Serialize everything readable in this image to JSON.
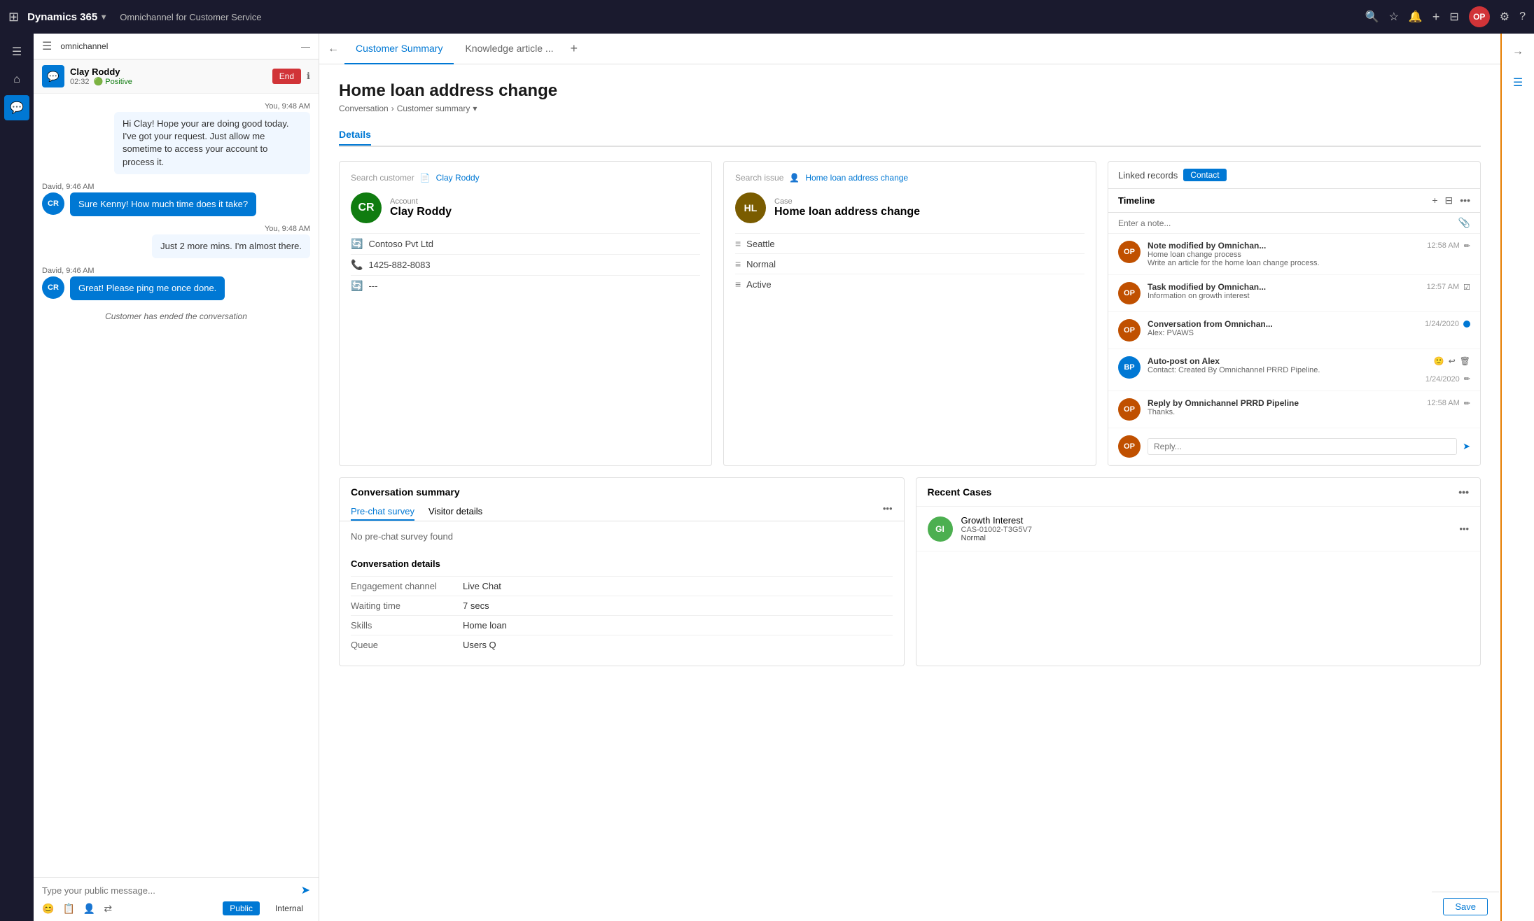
{
  "app": {
    "name": "Dynamics 365",
    "context": "Omnichannel for Customer Service"
  },
  "topnav": {
    "search_icon": "🔍",
    "star_icon": "☆",
    "bell_icon": "🔔",
    "plus_icon": "+",
    "filter_icon": "⊟",
    "settings_icon": "⚙",
    "help_icon": "?",
    "user_initials": "OP"
  },
  "sidebar": {
    "channel_label": "omnichannel"
  },
  "conversation": {
    "name": "Clay Roddy",
    "time": "02:32",
    "sentiment": "Positive",
    "end_button": "End",
    "messages": [
      {
        "id": 1,
        "sender": "you",
        "time": "You, 9:48 AM",
        "text": "Hi Clay! Hope your are doing good today. I've got your request. Just allow me sometime to access your account to process it."
      },
      {
        "id": 2,
        "sender": "CR",
        "time": "David, 9:46 AM",
        "text": "Sure Kenny! How much time does it take?"
      },
      {
        "id": 3,
        "sender": "you",
        "time": "You, 9:48 AM",
        "text": "Just 2 more mins. I'm almost there."
      },
      {
        "id": 4,
        "sender": "CR",
        "time": "David, 9:46 AM",
        "text": "Great! Please ping me once done."
      }
    ],
    "system_msg": "Customer has ended the conversation",
    "input_placeholder": "Type your public message...",
    "public_btn": "Public",
    "internal_btn": "Internal"
  },
  "tabs": {
    "customer_summary": "Customer Summary",
    "knowledge_article": "Knowledge article ...",
    "add_icon": "+"
  },
  "main": {
    "page_title": "Home loan address change",
    "breadcrumb_conversation": "Conversation",
    "breadcrumb_summary": "Customer summary",
    "details_tab": "Details",
    "customer_card": {
      "search_label": "Search customer",
      "search_link": "Clay Roddy",
      "account_label": "Account",
      "name": "Clay Roddy",
      "initials": "CR",
      "avatar_bg": "#107c10",
      "company": "Contoso Pvt Ltd",
      "phone": "1425-882-8083",
      "field3": "---"
    },
    "case_card": {
      "search_label": "Search issue",
      "search_link": "Home loan address change",
      "case_label": "Case",
      "title": "Home loan address change",
      "initials": "HL",
      "avatar_bg": "#7a5c00",
      "location": "Seattle",
      "priority": "Normal",
      "status": "Active"
    },
    "timeline": {
      "linked_records": "Linked records",
      "contact_btn": "Contact",
      "timeline_label": "Timeline",
      "note_placeholder": "Enter a note...",
      "items": [
        {
          "id": 1,
          "initials": "OP",
          "avatar_bg": "#c05000",
          "title": "Note modified by Omnichan...",
          "subtitle": "Home loan change process",
          "body": "Write an article for the home loan change process.",
          "time": "12:58 AM"
        },
        {
          "id": 2,
          "initials": "OP",
          "avatar_bg": "#c05000",
          "title": "Task modified by Omnichan...",
          "subtitle": "Information on growth interest",
          "body": "",
          "time": "12:57 AM"
        },
        {
          "id": 3,
          "initials": "OP",
          "avatar_bg": "#c05000",
          "title": "Conversation from Omnichan...",
          "subtitle": "Alex: PVAWS",
          "body": "",
          "time": "1/24/2020"
        },
        {
          "id": 4,
          "initials": "BP",
          "avatar_bg": "#0078d4",
          "title": "Auto-post on Alex",
          "subtitle": "Contact: Created By Omnichannel PRRD Pipeline.",
          "body": "",
          "time": "1/24/2020"
        },
        {
          "id": 5,
          "initials": "OP",
          "avatar_bg": "#c05000",
          "title": "Reply by Omnichannel PRRD Pipeline",
          "subtitle": "Thanks.",
          "body": "",
          "time": "12:58 AM"
        }
      ],
      "reply_placeholder": "Reply..."
    },
    "conversation_summary": {
      "title": "Conversation summary",
      "tab_prechat": "Pre-chat survey",
      "tab_visitor": "Visitor details",
      "no_survey": "No pre-chat survey found",
      "details_title": "Conversation details",
      "fields": [
        {
          "label": "Engagement channel",
          "value": "Live Chat"
        },
        {
          "label": "Waiting time",
          "value": "7 secs"
        },
        {
          "label": "Skills",
          "value": "Home loan"
        },
        {
          "label": "Queue",
          "value": "Users Q"
        }
      ]
    },
    "recent_cases": {
      "title": "Recent Cases",
      "items": [
        {
          "initials": "GI",
          "avatar_bg": "#4caf50",
          "name": "Growth Interest",
          "case_id": "CAS-01002-T3G5V7",
          "priority": "Normal"
        }
      ]
    }
  },
  "footer": {
    "save_label": "Save"
  }
}
